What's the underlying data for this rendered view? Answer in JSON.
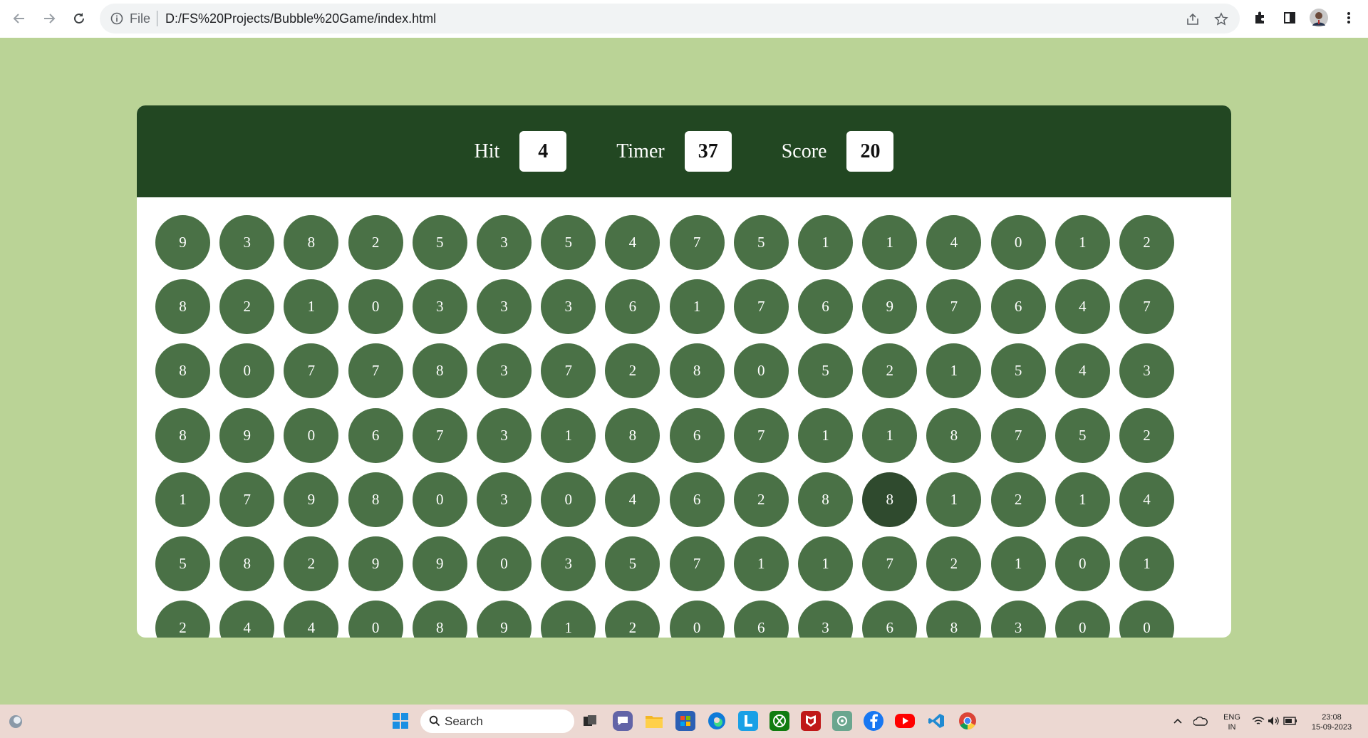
{
  "browser": {
    "file_label": "File",
    "url": "D:/FS%20Projects/Bubble%20Game/index.html"
  },
  "game": {
    "hit": {
      "label": "Hit",
      "value": "4"
    },
    "timer": {
      "label": "Timer",
      "value": "37"
    },
    "score": {
      "label": "Score",
      "value": "20"
    },
    "bubble_color": "#4a7146",
    "header_color": "#224722",
    "background_color": "#bad396",
    "hovered_bubble": {
      "row": 5,
      "col": 12
    },
    "rows": [
      [
        "9",
        "3",
        "8",
        "2",
        "5",
        "3",
        "5",
        "4",
        "7",
        "5",
        "1",
        "1",
        "4",
        "0",
        "1",
        "2"
      ],
      [
        "8",
        "2",
        "1",
        "0",
        "3",
        "3",
        "3",
        "6",
        "1",
        "7",
        "6",
        "9",
        "7",
        "6",
        "4",
        "7"
      ],
      [
        "8",
        "0",
        "7",
        "7",
        "8",
        "3",
        "7",
        "2",
        "8",
        "0",
        "5",
        "2",
        "1",
        "5",
        "4",
        "3"
      ],
      [
        "8",
        "9",
        "0",
        "6",
        "7",
        "3",
        "1",
        "8",
        "6",
        "7",
        "1",
        "1",
        "8",
        "7",
        "5",
        "2"
      ],
      [
        "1",
        "7",
        "9",
        "8",
        "0",
        "3",
        "0",
        "4",
        "6",
        "2",
        "8",
        "8",
        "1",
        "2",
        "1",
        "4"
      ],
      [
        "5",
        "8",
        "2",
        "9",
        "9",
        "0",
        "3",
        "5",
        "7",
        "1",
        "1",
        "7",
        "2",
        "1",
        "0",
        "1"
      ],
      [
        "2",
        "4",
        "4",
        "0",
        "8",
        "9",
        "1",
        "2",
        "0",
        "6",
        "3",
        "6",
        "8",
        "3",
        "0",
        "0"
      ]
    ]
  },
  "taskbar": {
    "search_placeholder": "Search",
    "lang_top": "ENG",
    "lang_bottom": "IN",
    "time": "23:08",
    "date": "15-09-2023"
  }
}
